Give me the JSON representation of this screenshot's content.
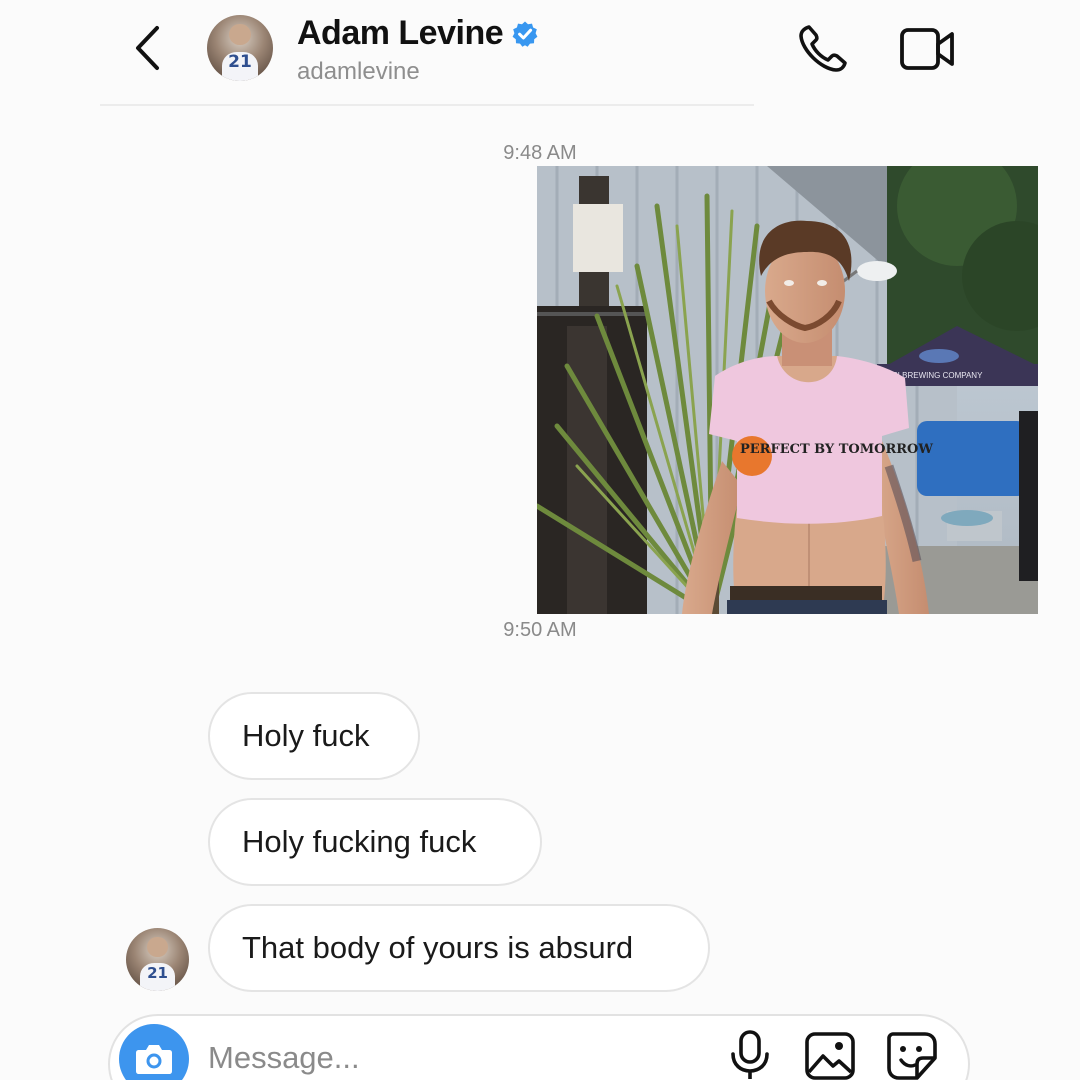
{
  "header": {
    "name": "Adam Levine",
    "handle": "adamlevine",
    "avatar_number": "21",
    "verified": true,
    "icons": [
      "chevron-left-icon",
      "phone-icon",
      "video-camera-icon",
      "verified-badge-icon"
    ]
  },
  "conversation": {
    "timestamps": [
      "9:48 AM",
      "9:50 AM"
    ],
    "photo_caption": "PERFECT BY TOMORROW",
    "photo_sign": "ASI BREWING COMPANY",
    "messages": [
      {
        "text": "Holy fuck"
      },
      {
        "text": "Holy fucking fuck"
      },
      {
        "text": "That body of yours is absurd"
      }
    ],
    "sender_avatar_number": "21"
  },
  "composer": {
    "placeholder": "Message...",
    "icons": [
      "camera-icon",
      "microphone-icon",
      "image-icon",
      "sticker-icon"
    ]
  },
  "colors": {
    "verified_blue": "#3897f0",
    "camera_button": "#3d95ee",
    "bubble_border": "#e4e4e4",
    "timestamp_gray": "#8a8a8a"
  }
}
